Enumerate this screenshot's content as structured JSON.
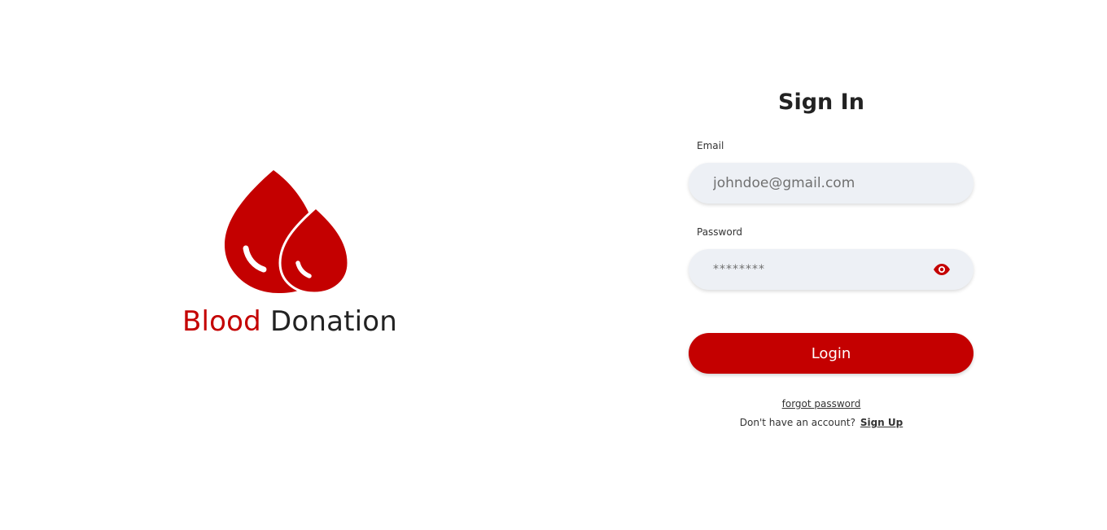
{
  "brand": {
    "word_1": "Blood",
    "word_2": "Donation",
    "logo_icon": "blood-drops-icon",
    "accent_color": "#c40000"
  },
  "signin": {
    "title": "Sign In",
    "email": {
      "label": "Email",
      "placeholder": "johndoe@gmail.com",
      "value": ""
    },
    "password": {
      "label": "Password",
      "placeholder": "********",
      "value": "",
      "toggle_icon": "eye-icon"
    },
    "login_label": "Login",
    "forgot_label": "forgot password",
    "signup_prompt": "Don't have an account?",
    "signup_label": "Sign Up"
  },
  "colors": {
    "primary": "#c40000",
    "input_background": "#edf0f5",
    "text": "#222222"
  }
}
